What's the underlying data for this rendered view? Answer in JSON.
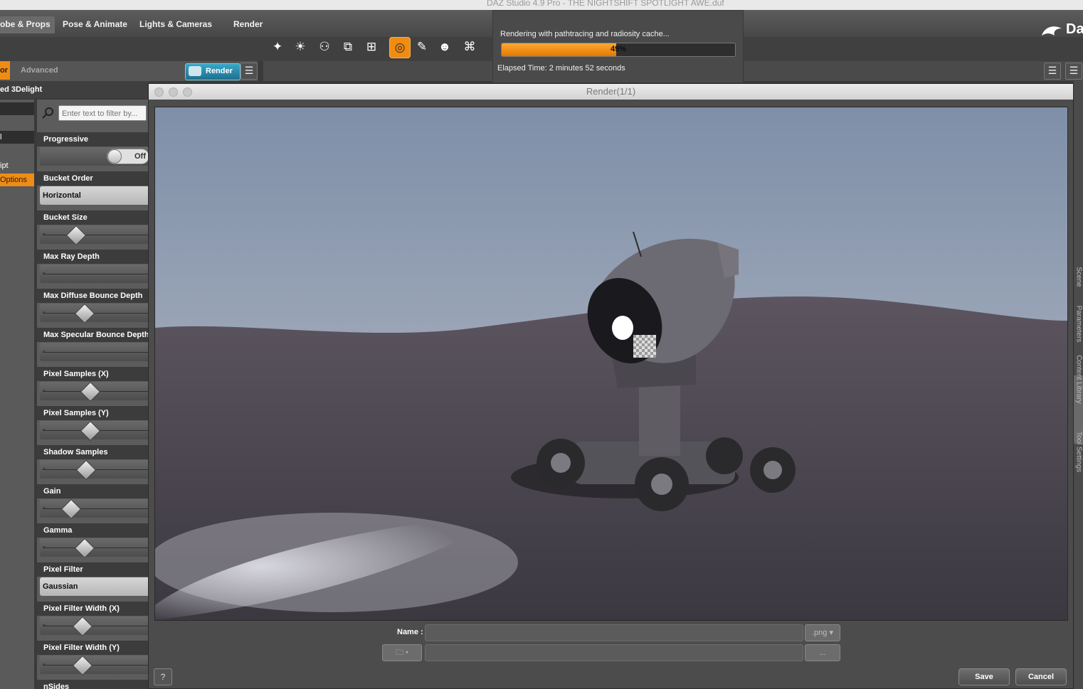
{
  "window": {
    "title": "DAZ Studio 4.9 Pro - THE NIGHTSHIFT SPOTLIGHT AWE.duf"
  },
  "nav": {
    "tabs": [
      "obe & Props",
      "Pose & Animate",
      "Lights & Cameras",
      "Render"
    ],
    "logo_text": "Da"
  },
  "toolbar": {
    "tools": [
      "node-light-icon",
      "sun-icon",
      "figure-pose-icon",
      "group-icon",
      "scene-icon",
      "target-icon",
      "surface-icon",
      "figure-icon",
      "camera-icon"
    ],
    "active_tool": "target-icon",
    "accent": "#ef8c14"
  },
  "render_settings": {
    "tabs": [
      "or",
      "Advanced"
    ],
    "render_button": "Render",
    "engine": "ed 3Delight",
    "filter_placeholder": "Enter text to filter by...",
    "left_nav": [
      "",
      "l",
      "",
      "ipt",
      "Options"
    ],
    "properties": [
      {
        "label": "Progressive",
        "type": "toggle",
        "value": "Off"
      },
      {
        "label": "Bucket Order",
        "type": "select",
        "value": "Horizontal"
      },
      {
        "label": "Bucket Size",
        "type": "slider",
        "level": 0.25
      },
      {
        "label": "Max Ray Depth",
        "type": "slider",
        "level": null
      },
      {
        "label": "Max Diffuse Bounce Depth",
        "type": "slider",
        "level": 0.35
      },
      {
        "label": "Max Specular Bounce Depth",
        "type": "slider",
        "level": null
      },
      {
        "label": "Pixel Samples (X)",
        "type": "slider",
        "level": 0.42
      },
      {
        "label": "Pixel Samples (Y)",
        "type": "slider",
        "level": 0.42
      },
      {
        "label": "Shadow Samples",
        "type": "slider",
        "level": 0.37
      },
      {
        "label": "Gain",
        "type": "slider",
        "level": 0.2
      },
      {
        "label": "Gamma",
        "type": "slider",
        "level": 0.35
      },
      {
        "label": "Pixel Filter",
        "type": "select",
        "value": "Gaussian"
      },
      {
        "label": "Pixel Filter Width (X)",
        "type": "slider",
        "level": 0.33
      },
      {
        "label": "Pixel Filter Width (Y)",
        "type": "slider",
        "level": 0.33
      },
      {
        "label": "nSides",
        "type": "slider",
        "level": null
      }
    ]
  },
  "progress": {
    "message": "Rendering with pathtracing and radiosity cache...",
    "percent": 49,
    "percent_label": "49%",
    "elapsed": "Elapsed Time:  2 minutes 52 seconds"
  },
  "render_window": {
    "title": "Render(1/1)",
    "name_label": "Name :",
    "name_value": "",
    "format": ".png",
    "path_value": "",
    "browse_label": "...",
    "help_label": "?",
    "save_label": "Save",
    "cancel_label": "Cancel"
  },
  "right_tabs": [
    "Scene",
    "Parameters",
    "Content Library",
    "Tool Settings"
  ],
  "right_tabs_active": "Content Library"
}
